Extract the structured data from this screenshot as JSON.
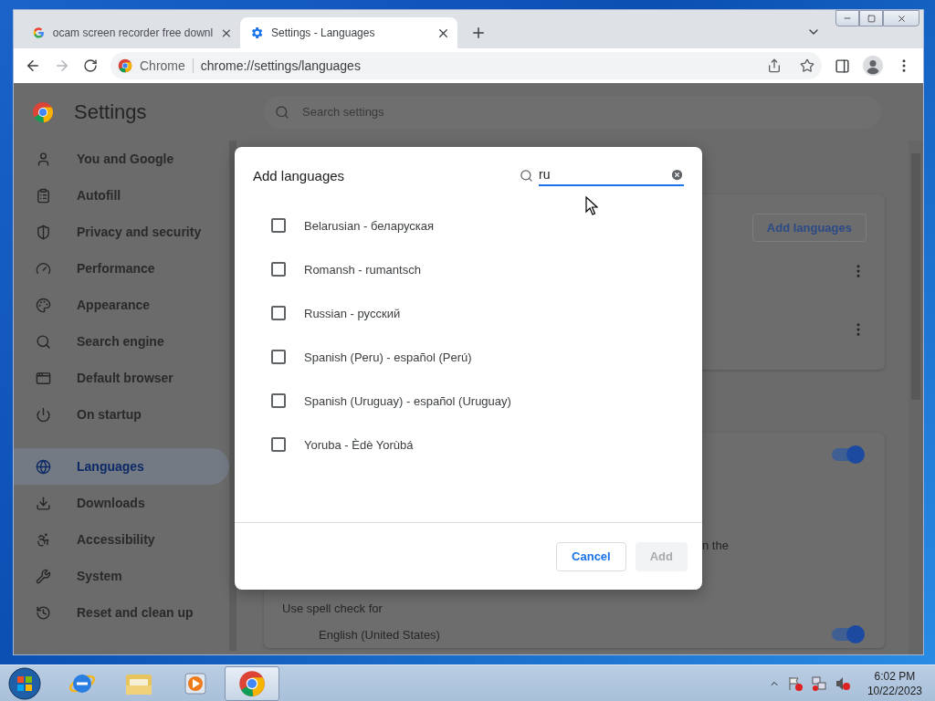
{
  "browser": {
    "tabs": [
      {
        "title": "ocam screen recorder free downl",
        "selected": false
      },
      {
        "title": "Settings - Languages",
        "selected": true
      }
    ],
    "address_bar": {
      "site_chip": "Chrome",
      "url": "chrome://settings/languages"
    }
  },
  "settings": {
    "title": "Settings",
    "search": {
      "placeholder": "Search settings"
    },
    "nav": [
      {
        "label": "You and Google",
        "selected": false
      },
      {
        "label": "Autofill",
        "selected": false
      },
      {
        "label": "Privacy and security",
        "selected": false
      },
      {
        "label": "Performance",
        "selected": false
      },
      {
        "label": "Appearance",
        "selected": false
      },
      {
        "label": "Search engine",
        "selected": false
      },
      {
        "label": "Default browser",
        "selected": false
      },
      {
        "label": "On startup",
        "selected": false
      },
      {
        "label": "Languages",
        "selected": true
      },
      {
        "label": "Downloads",
        "selected": false
      },
      {
        "label": "Accessibility",
        "selected": false
      },
      {
        "label": "System",
        "selected": false
      },
      {
        "label": "Reset and clean up",
        "selected": false
      }
    ]
  },
  "page": {
    "add_languages_button": "Add languages",
    "spell_check": {
      "on": true,
      "partial_text": "n the",
      "use_for_label": "Use spell check for",
      "languages": [
        {
          "name": "English (United States)",
          "on": true
        }
      ]
    }
  },
  "dialog": {
    "title": "Add languages",
    "search": {
      "value": "ru"
    },
    "languages": [
      {
        "name": "Belarusian - беларуская",
        "checked": false
      },
      {
        "name": "Romansh - rumantsch",
        "checked": false
      },
      {
        "name": "Russian - русский",
        "checked": false
      },
      {
        "name": "Spanish (Peru) - español (Perú)",
        "checked": false
      },
      {
        "name": "Spanish (Uruguay) - español (Uruguay)",
        "checked": false
      },
      {
        "name": "Yoruba - Èdè Yorùbá",
        "checked": false
      }
    ],
    "buttons": [
      {
        "label": "Cancel",
        "kind": "secondary",
        "disabled": false
      },
      {
        "label": "Add",
        "kind": "primary",
        "disabled": true
      }
    ]
  },
  "taskbar": {
    "apps": [
      {
        "selected": false
      },
      {
        "selected": false
      },
      {
        "selected": false
      },
      {
        "selected": true
      }
    ],
    "clock": {
      "time": "6:02 PM",
      "date": "10/22/2023"
    }
  }
}
